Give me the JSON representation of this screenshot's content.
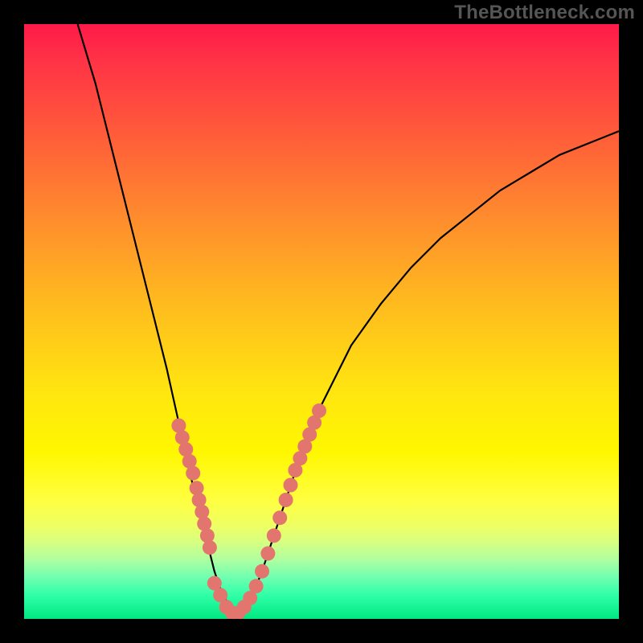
{
  "watermark": "TheBottleneck.com",
  "chart_data": {
    "type": "line",
    "title": "",
    "xlabel": "",
    "ylabel": "",
    "xlim": [
      0,
      100
    ],
    "ylim": [
      0,
      100
    ],
    "grid": false,
    "series": [
      {
        "name": "bottleneck-curve",
        "stroke": "#000000",
        "x": [
          9,
          12,
          15,
          18,
          21,
          24,
          26,
          28,
          30,
          31,
          32,
          33,
          34,
          35,
          36,
          37,
          38,
          40,
          42,
          44,
          46,
          50,
          55,
          60,
          65,
          70,
          75,
          80,
          85,
          90,
          95,
          100
        ],
        "y": [
          100,
          90,
          78,
          66,
          54,
          42,
          33,
          24,
          16,
          12,
          8,
          5,
          3,
          1,
          0,
          1,
          3,
          8,
          14,
          20,
          26,
          36,
          46,
          53,
          59,
          64,
          68,
          72,
          75,
          78,
          80,
          82
        ]
      }
    ],
    "marker_clusters": [
      {
        "name": "left-cluster",
        "color": "#e2766f",
        "points": [
          [
            26.0,
            32.5
          ],
          [
            26.6,
            30.5
          ],
          [
            27.2,
            28.5
          ],
          [
            27.8,
            26.5
          ],
          [
            28.4,
            24.5
          ],
          [
            29.0,
            22.0
          ],
          [
            29.4,
            20.0
          ],
          [
            29.9,
            18.0
          ],
          [
            30.3,
            16.0
          ],
          [
            30.8,
            14.0
          ],
          [
            31.2,
            12.0
          ]
        ]
      },
      {
        "name": "valley-cluster",
        "color": "#e2766f",
        "points": [
          [
            32.0,
            6.0
          ],
          [
            33.0,
            4.0
          ],
          [
            34.0,
            2.0
          ],
          [
            35.0,
            1.0
          ],
          [
            36.0,
            1.0
          ],
          [
            37.0,
            2.0
          ],
          [
            38.0,
            3.5
          ],
          [
            39.0,
            5.5
          ],
          [
            40.0,
            8.0
          ]
        ]
      },
      {
        "name": "right-cluster",
        "color": "#e2766f",
        "points": [
          [
            41.0,
            11.0
          ],
          [
            42.0,
            14.0
          ],
          [
            43.0,
            17.0
          ],
          [
            44.0,
            20.0
          ],
          [
            44.8,
            22.5
          ],
          [
            45.6,
            25.0
          ],
          [
            46.4,
            27.0
          ],
          [
            47.2,
            29.0
          ],
          [
            48.0,
            31.0
          ],
          [
            48.8,
            33.0
          ],
          [
            49.6,
            35.0
          ]
        ]
      }
    ]
  }
}
